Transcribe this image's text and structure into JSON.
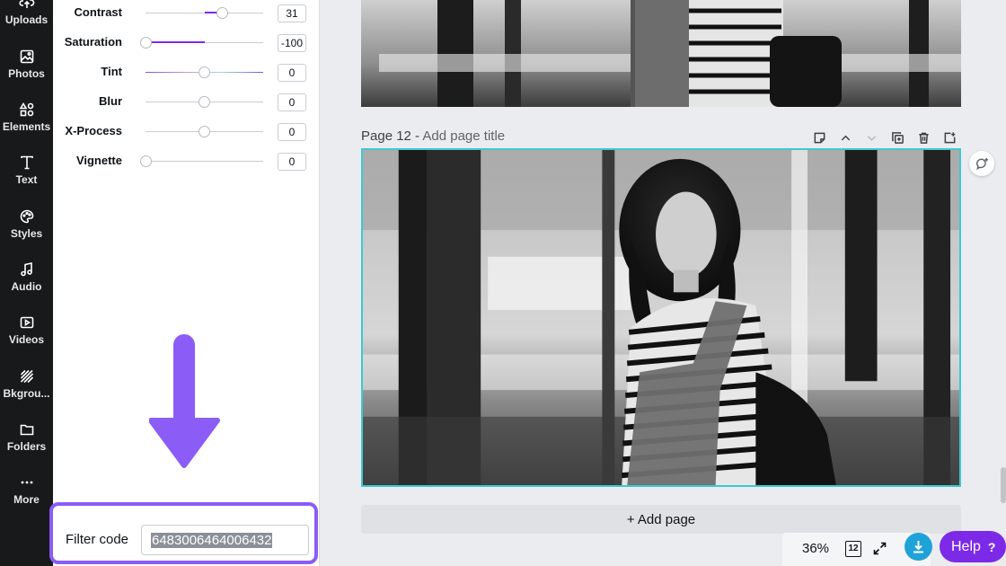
{
  "sidebar": {
    "items": [
      {
        "label": "Uploads",
        "icon": "upload-icon"
      },
      {
        "label": "Photos",
        "icon": "photo-icon"
      },
      {
        "label": "Elements",
        "icon": "shapes-icon"
      },
      {
        "label": "Text",
        "icon": "text-icon"
      },
      {
        "label": "Styles",
        "icon": "palette-icon"
      },
      {
        "label": "Audio",
        "icon": "music-icon"
      },
      {
        "label": "Videos",
        "icon": "video-icon"
      },
      {
        "label": "Bkgrou...",
        "icon": "background-icon"
      },
      {
        "label": "Folders",
        "icon": "folder-icon"
      },
      {
        "label": "More",
        "icon": "more-icon"
      }
    ]
  },
  "adjust": {
    "sliders": [
      {
        "label": "Contrast",
        "value": "31",
        "level": 31
      },
      {
        "label": "Saturation",
        "value": "-100",
        "level": -100
      },
      {
        "label": "Tint",
        "value": "0",
        "level": 0
      },
      {
        "label": "Blur",
        "value": "0",
        "level": 0
      },
      {
        "label": "X-Process",
        "value": "0",
        "level": 0
      },
      {
        "label": "Vignette",
        "value": "0",
        "level": 0
      }
    ],
    "accent_color": "#7d2ae8"
  },
  "filter": {
    "label": "Filter code",
    "code": "6483006464006432",
    "highlight_color": "#8b5cf6"
  },
  "page": {
    "number_label": "Page 12 -",
    "title_placeholder": "Add page title",
    "selection_color": "#3ec8d2"
  },
  "actions": {
    "add_page": "+ Add page",
    "help": "Help",
    "help_mark": "?"
  },
  "status": {
    "zoom": "36%",
    "page_count": "12"
  }
}
